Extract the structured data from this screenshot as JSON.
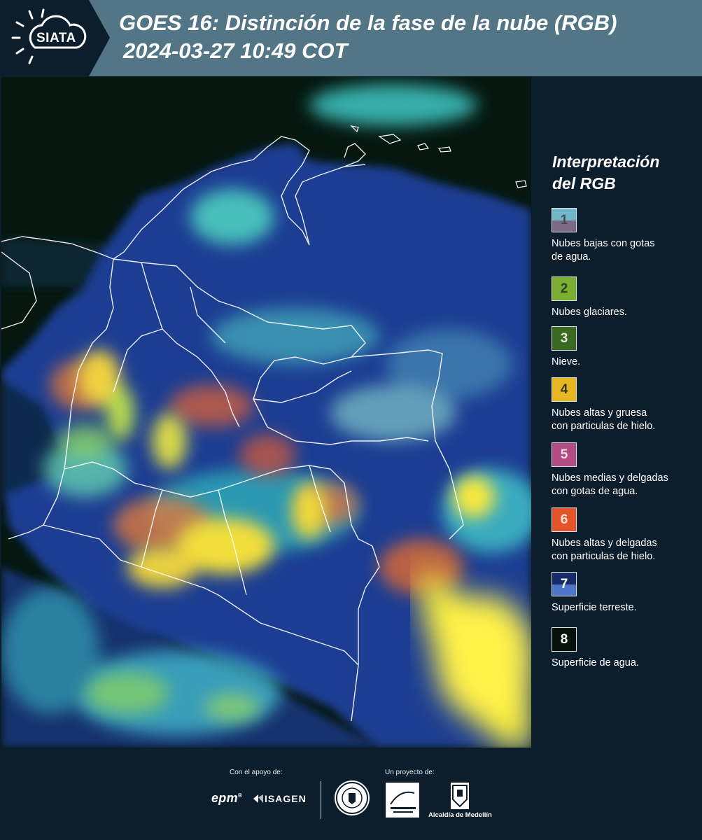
{
  "header": {
    "logo_text": "SIATA",
    "title": "GOES 16: Distinción de la fase de la nube (RGB)",
    "subtitle": "2024-03-27 10:49 COT"
  },
  "legend": {
    "title_line1": "Interpretación",
    "title_line2": "del RGB",
    "items": [
      {
        "number": "1",
        "label_line1": "Nubes bajas con gotas",
        "label_line2": "de agua.",
        "color_top": "#72b7c7",
        "color_bottom": "#7a6a88",
        "text_color": "#4b4b55"
      },
      {
        "number": "2",
        "label_line1": "Nubes glaciares.",
        "label_line2": "",
        "color_top": "#7aaf32",
        "color_bottom": "#7aaf32",
        "text_color": "#2f3f22"
      },
      {
        "number": "3",
        "label_line1": "Nieve.",
        "label_line2": "",
        "color_top": "#3a6a22",
        "color_bottom": "#3a6a22",
        "text_color": "#dfe8d8"
      },
      {
        "number": "4",
        "label_line1": "Nubes altas y gruesa",
        "label_line2": "con particulas de hielo.",
        "color_top": "#e6b721",
        "color_bottom": "#e6b721",
        "text_color": "#3b3420"
      },
      {
        "number": "5",
        "label_line1": "Nubes medias y delgadas",
        "label_line2": "con gotas de agua.",
        "color_top": "#b14d84",
        "color_bottom": "#b14d84",
        "text_color": "#f3dbe6"
      },
      {
        "number": "6",
        "label_line1": "Nubes altas y delgadas",
        "label_line2": "con particulas de hielo.",
        "color_top": "#e4532a",
        "color_bottom": "#e4532a",
        "text_color": "#fbe5dc"
      },
      {
        "number": "7",
        "label_line1": "Superficie terreste.",
        "label_line2": "",
        "color_top": "#162a6a",
        "color_bottom": "#4e75c8",
        "text_color": "#ffffff"
      },
      {
        "number": "8",
        "label_line1": "Superficie de agua.",
        "label_line2": "",
        "color_top": "#031108",
        "color_bottom": "#031108",
        "text_color": "#ffffff"
      }
    ]
  },
  "footer": {
    "support_label": "Con el apoyo de:",
    "project_label": "Un proyecto de:",
    "sponsor1": "epm",
    "sponsor2": "ISAGEN",
    "org3": "Alcaldía de Medellín"
  }
}
